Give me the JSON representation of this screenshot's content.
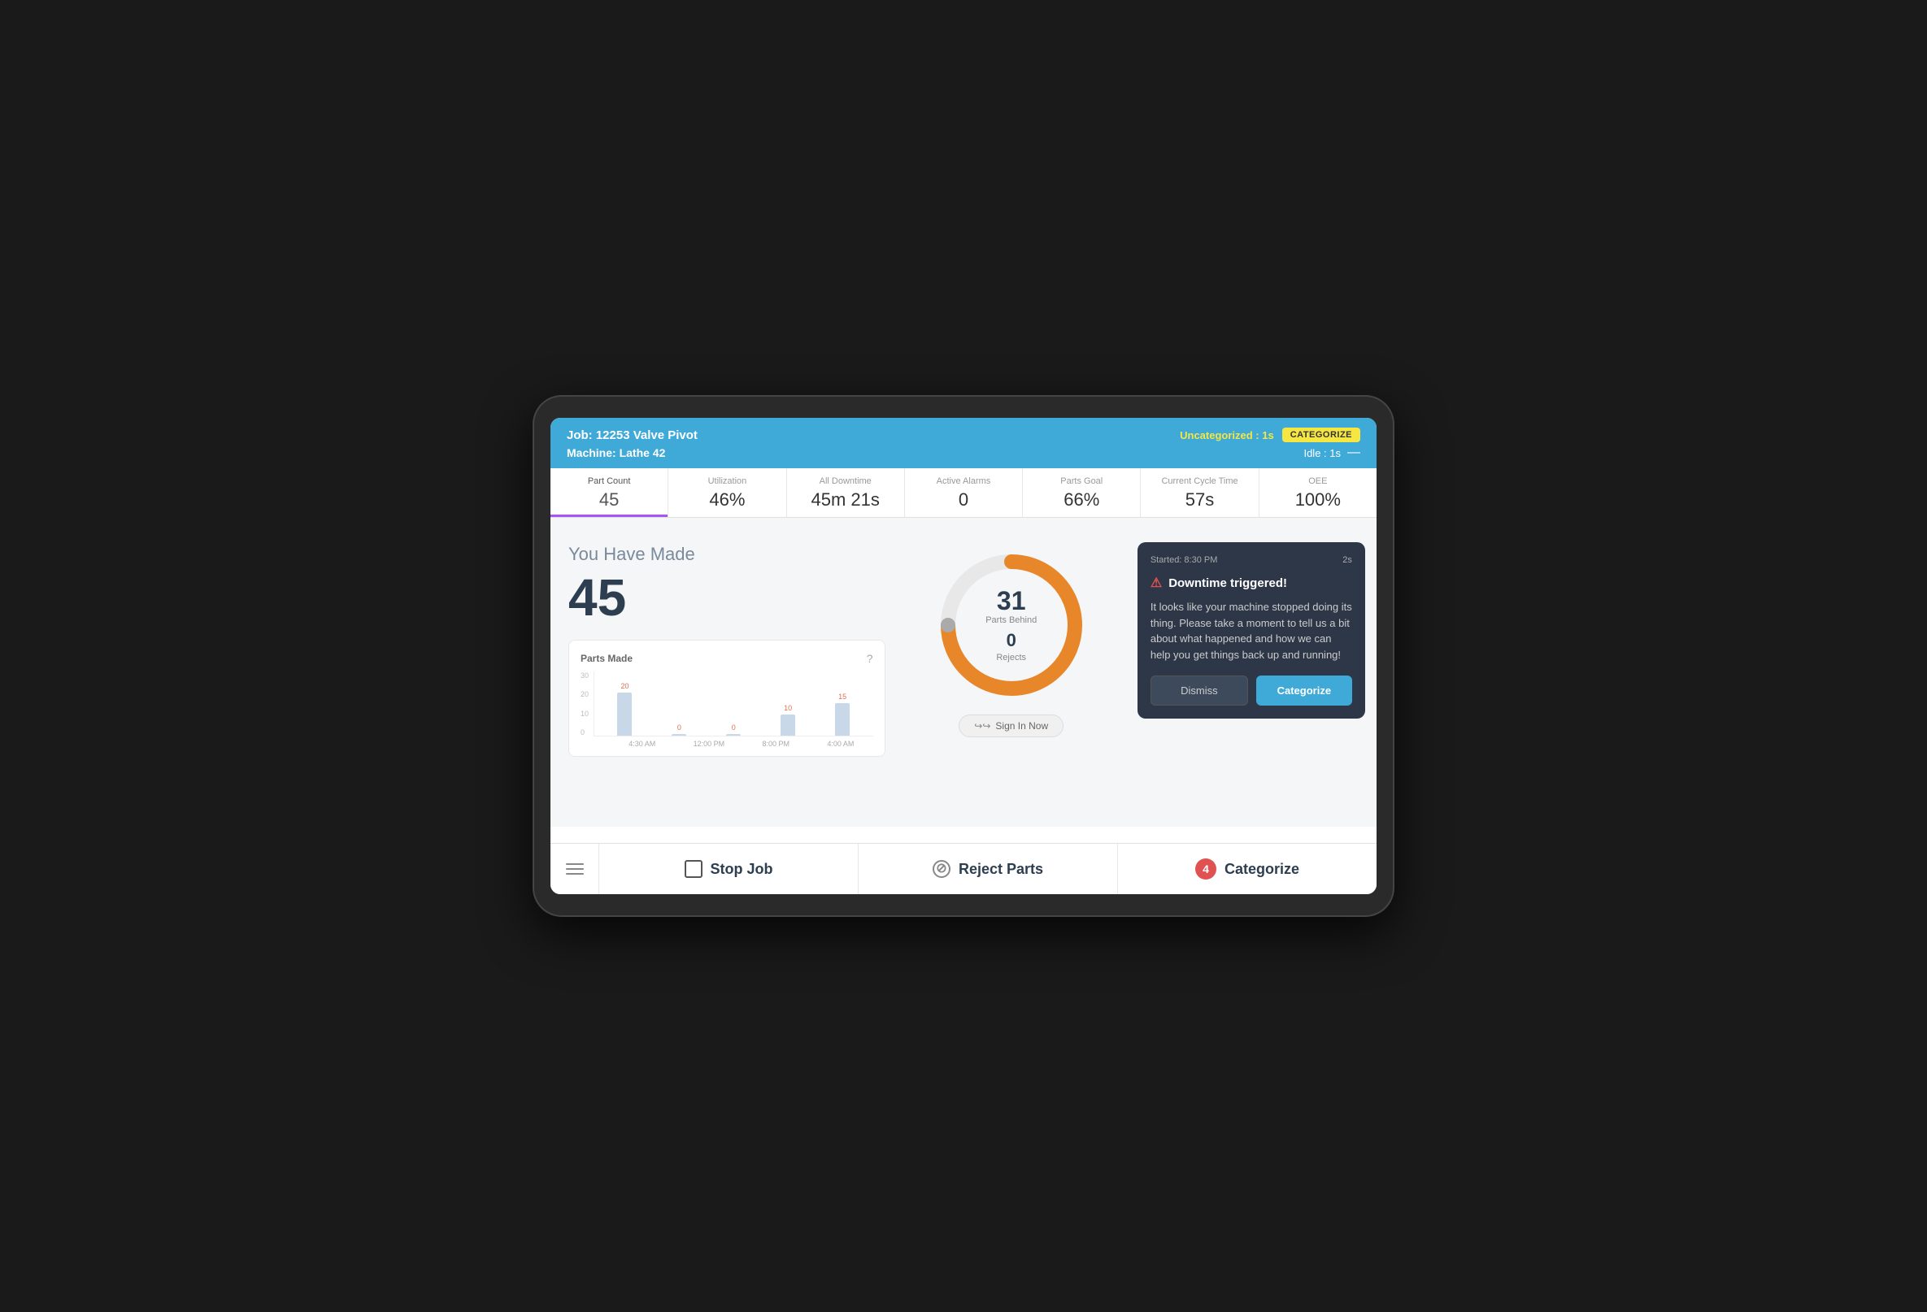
{
  "header": {
    "job_label": "Job: 12253 Valve Pivot",
    "machine_label": "Machine: Lathe 42",
    "uncategorized_text": "Uncategorized : 1s",
    "categorize_btn": "CATEGORIZE",
    "idle_text": "Idle : 1s"
  },
  "stats": [
    {
      "label": "Part Count",
      "value": "45",
      "active": true
    },
    {
      "label": "Utilization",
      "value": "46%",
      "active": false
    },
    {
      "label": "All Downtime",
      "value": "45m 21s",
      "active": false
    },
    {
      "label": "Active Alarms",
      "value": "0",
      "active": false
    },
    {
      "label": "Parts Goal",
      "value": "66%",
      "active": false
    },
    {
      "label": "Current Cycle Time",
      "value": "57s",
      "active": false
    },
    {
      "label": "OEE",
      "value": "100%",
      "active": false
    }
  ],
  "main": {
    "you_have_made": "You Have Made",
    "count": "45",
    "chart_title": "Parts Made",
    "chart_help": "?",
    "chart_bars": [
      {
        "value": "20",
        "height": 53,
        "label": "4:30 AM"
      },
      {
        "value": "0",
        "height": 0,
        "label": "12:00 PM"
      },
      {
        "value": "0",
        "height": 0,
        "label": ""
      },
      {
        "value": "10",
        "height": 26,
        "label": "8:00 PM"
      },
      {
        "value": "15",
        "height": 40,
        "label": "4:00 AM"
      }
    ],
    "chart_y_labels": [
      "30",
      "20",
      "10",
      "0"
    ],
    "donut": {
      "parts_behind": "31",
      "parts_behind_label": "Parts Behind",
      "rejects": "0",
      "rejects_label": "Rejects"
    },
    "sign_in_btn": "Sign In Now"
  },
  "downtime_popup": {
    "started": "Started: 8:30 PM",
    "time": "2s",
    "title": "Downtime triggered!",
    "body": "It looks like your machine stopped doing its thing. Please take a moment to tell us a bit about what happened and how we can help you get things back up and running!",
    "dismiss_btn": "Dismiss",
    "categorize_btn": "Categorize"
  },
  "bottom_bar": {
    "stop_job_label": "Stop Job",
    "reject_parts_label": "Reject Parts",
    "categorize_label": "Categorize",
    "categorize_count": "4"
  }
}
